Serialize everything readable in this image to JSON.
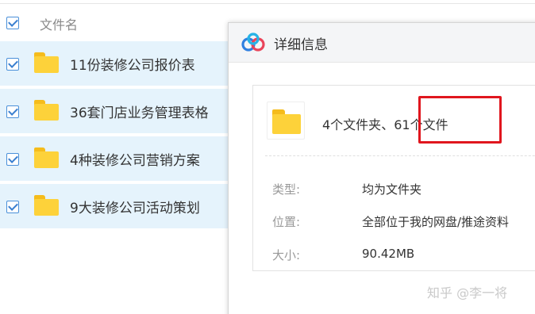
{
  "file_list": {
    "header": {
      "label": "文件名",
      "checked": true
    },
    "items": [
      {
        "name": "11份装修公司报价表",
        "checked": true,
        "icon": "folder-icon"
      },
      {
        "name": "36套门店业务管理表格",
        "checked": true,
        "icon": "folder-icon"
      },
      {
        "name": "4种装修公司营销方案",
        "checked": true,
        "icon": "folder-icon"
      },
      {
        "name": "9大装修公司活动策划",
        "checked": true,
        "icon": "folder-icon"
      }
    ]
  },
  "dialog": {
    "title": "详细信息",
    "logo_icon": "baidu-netdisk-logo-icon",
    "summary": {
      "folders": "4个文件夹",
      "separator": "、",
      "files": "61个文件"
    },
    "fields": [
      {
        "label": "类型:",
        "value": "均为文件夹"
      },
      {
        "label": "位置:",
        "value": "全部位于我的网盘/推途资料"
      },
      {
        "label": "大小:",
        "value": "90.42MB"
      }
    ]
  },
  "watermark": "知乎 @李一将",
  "colors": {
    "row_selected_bg": "#e5f3fc",
    "folder_yellow": "#fdd23a",
    "checkbox_blue": "#3a7fd0",
    "highlight_red": "#e0161e",
    "dialog_header_bg": "#f4f5f7"
  }
}
